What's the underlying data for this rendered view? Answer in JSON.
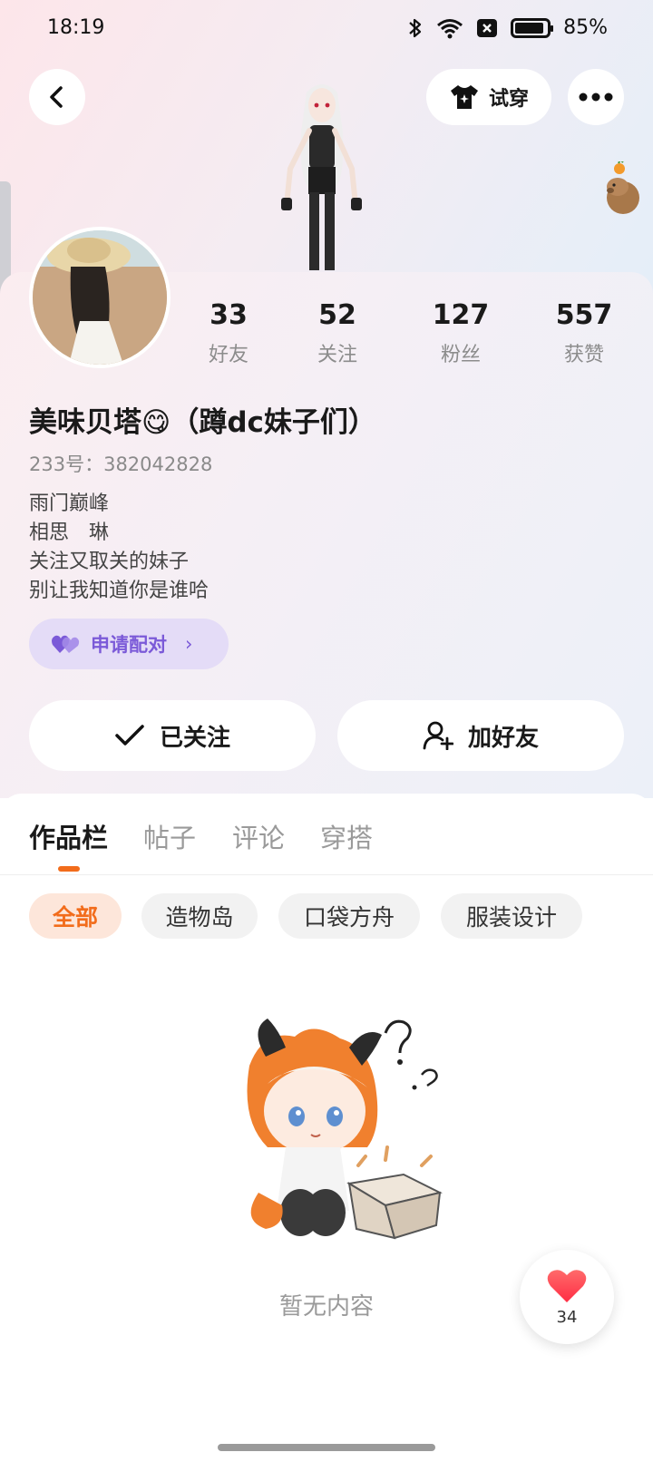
{
  "status_bar": {
    "time": "18:19",
    "battery": "85%",
    "icons": [
      "bluetooth-icon",
      "wifi-icon",
      "no-sim-icon",
      "battery-icon"
    ]
  },
  "header": {
    "try_on_label": "试穿",
    "icons": [
      "back-icon",
      "tshirt-icon",
      "more-icon"
    ]
  },
  "profile": {
    "stats": [
      {
        "value": "33",
        "label": "好友"
      },
      {
        "value": "52",
        "label": "关注"
      },
      {
        "value": "127",
        "label": "粉丝"
      },
      {
        "value": "557",
        "label": "获赞"
      }
    ],
    "nickname": "美味贝塔😋（蹲dc妹子们）",
    "uid": "233号：382042828",
    "bio": [
      "雨门巅峰",
      "相思　琳",
      "关注又取关的妹子",
      "别让我知道你是谁哈"
    ],
    "pair_button": "申请配对"
  },
  "actions": {
    "follow_label": "已关注",
    "add_friend_label": "加好友"
  },
  "tabs": [
    "作品栏",
    "帖子",
    "评论",
    "穿搭"
  ],
  "active_tab": "作品栏",
  "filters": [
    "全部",
    "造物岛",
    "口袋方舟",
    "服装设计"
  ],
  "active_filter": "全部",
  "empty_state": "暂无内容",
  "like_fab": {
    "count": "34"
  },
  "colors": {
    "accent": "#f26c1b",
    "pair_purple": "#7b5ad8",
    "heart": "#ff3b4a"
  }
}
